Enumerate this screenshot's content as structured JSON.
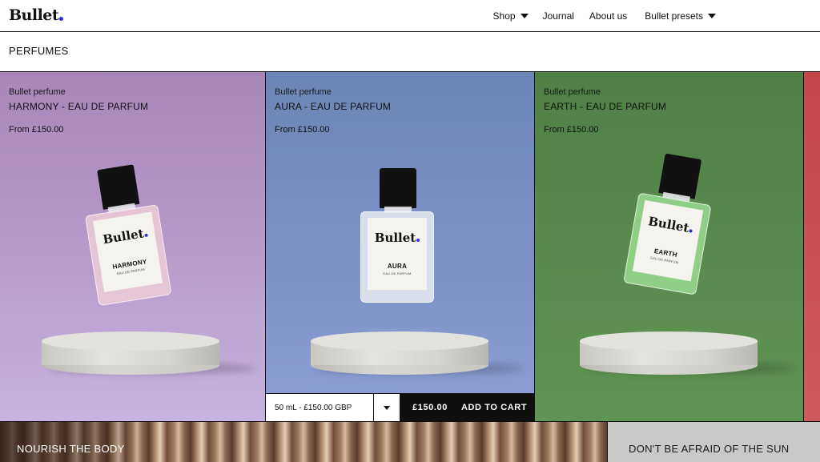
{
  "header": {
    "logo": "Bullet",
    "nav": [
      {
        "label": "Shop",
        "has_dropdown": true
      },
      {
        "label": "Journal",
        "has_dropdown": false
      },
      {
        "label": "About us",
        "has_dropdown": false
      },
      {
        "label": "Bullet presets",
        "has_dropdown": true
      }
    ]
  },
  "section": {
    "title": "PERFUMES"
  },
  "products": [
    {
      "brand": "Bullet perfume",
      "name": "HARMONY - EAU DE PARFUM",
      "price": "From £150.00",
      "label_logo": "Bullet",
      "label_name": "HARMONY",
      "label_sub": "EAU DE PARFUM",
      "color": "#b89ccb"
    },
    {
      "brand": "Bullet perfume",
      "name": "AURA - EAU DE PARFUM",
      "price": "From £150.00",
      "label_logo": "Bullet",
      "label_name": "AURA",
      "label_sub": "EAU DE PARFUM",
      "color": "#7f93c8"
    },
    {
      "brand": "Bullet perfume",
      "name": "EARTH - EAU DE PARFUM",
      "price": "From £150.00",
      "label_logo": "Bullet",
      "label_name": "EARTH",
      "label_sub": "EAU DE PARFUM",
      "color": "#5a8c4f"
    }
  ],
  "cart": {
    "variant": "50 mL - £150.00 GBP",
    "price": "£150.00",
    "add_label": "ADD TO CART"
  },
  "bottom_tiles": [
    {
      "title": "NOURISH THE BODY"
    },
    {
      "title": "DON'T BE AFRAID OF THE SUN"
    }
  ],
  "colors": {
    "accent_dot": "#2f2fd6",
    "button_bg": "#0f0f0f"
  }
}
